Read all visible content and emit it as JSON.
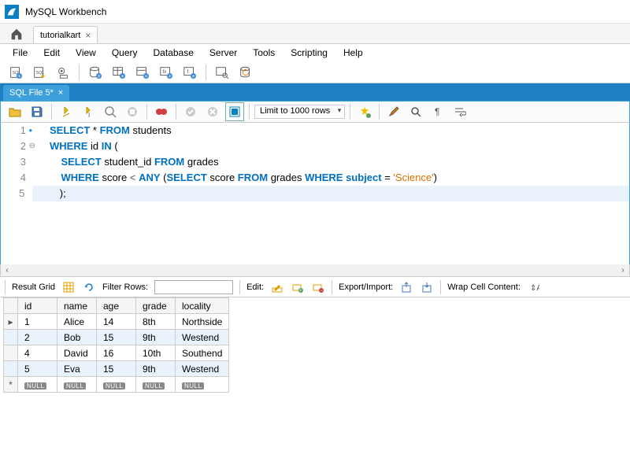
{
  "app": {
    "title": "MySQL Workbench"
  },
  "conn_tab": {
    "label": "tutorialkart"
  },
  "menu": [
    "File",
    "Edit",
    "View",
    "Query",
    "Database",
    "Server",
    "Tools",
    "Scripting",
    "Help"
  ],
  "sql_tab": {
    "label": "SQL File 5*"
  },
  "editor_toolbar": {
    "limit": "Limit to 1000 rows"
  },
  "code": {
    "lines": [
      {
        "n": 1,
        "marker": "dot",
        "html": "<span class='kw'>SELECT</span> * <span class='kw'>FROM</span> students"
      },
      {
        "n": 2,
        "marker": "fold",
        "html": "<span class='kw'>WHERE</span> id <span class='kw'>IN</span> ("
      },
      {
        "n": 3,
        "marker": "",
        "indent": "    ",
        "html": "<span class='kw'>SELECT</span> student_id <span class='kw'>FROM</span> grades"
      },
      {
        "n": 4,
        "marker": "",
        "indent": "    ",
        "html": "<span class='kw'>WHERE</span> score <span class='op'>&lt;</span> <span class='kw'>ANY</span> (<span class='kw'>SELECT</span> score <span class='kw'>FROM</span> grades <span class='kw'>WHERE</span> <span class='kw'>subject</span> = <span class='str'>'Science'</span>)"
      },
      {
        "n": 5,
        "marker": "",
        "indent": "    ",
        "current": true,
        "html": ");"
      }
    ]
  },
  "result_toolbar": {
    "grid_label": "Result Grid",
    "filter_label": "Filter Rows:",
    "filter_value": "",
    "edit_label": "Edit:",
    "export_label": "Export/Import:",
    "wrap_label": "Wrap Cell Content:"
  },
  "grid": {
    "columns": [
      "id",
      "name",
      "age",
      "grade",
      "locality"
    ],
    "rows": [
      {
        "id": "1",
        "name": "Alice",
        "age": "14",
        "grade": "8th",
        "locality": "Northside"
      },
      {
        "id": "2",
        "name": "Bob",
        "age": "15",
        "grade": "9th",
        "locality": "Westend"
      },
      {
        "id": "4",
        "name": "David",
        "age": "16",
        "grade": "10th",
        "locality": "Southend"
      },
      {
        "id": "5",
        "name": "Eva",
        "age": "15",
        "grade": "9th",
        "locality": "Westend"
      }
    ],
    "null_label": "NULL"
  }
}
